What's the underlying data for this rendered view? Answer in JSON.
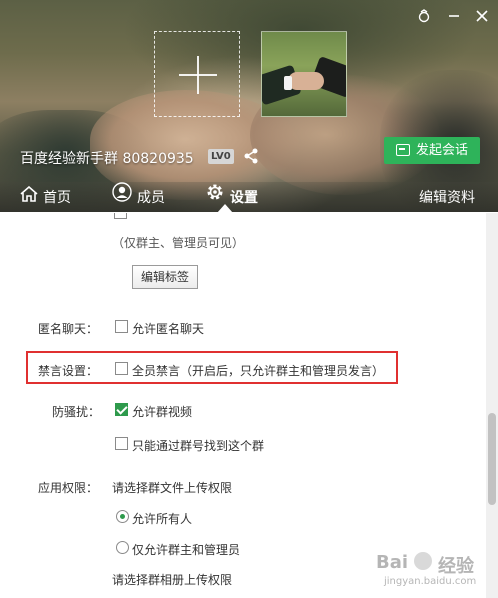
{
  "header": {
    "group_name": "百度经验新手群 80820935",
    "level": "LV0",
    "start_chat_label": "发起会话"
  },
  "nav": {
    "home": "首页",
    "members": "成员",
    "settings": "设置",
    "edit_profile": "编辑资料"
  },
  "content": {
    "visibility_note": "（仅群主、管理员可见）",
    "edit_tags_label": "编辑标签",
    "anonymous": {
      "label": "匿名聊天：",
      "option": "允许匿名聊天",
      "checked": false
    },
    "mute": {
      "label": "禁言设置：",
      "option": "全员禁言（开启后，只允许群主和管理员发言）",
      "checked": false
    },
    "anti_spam": {
      "label": "防骚扰：",
      "options": [
        {
          "text": "允许群视频",
          "checked": true
        },
        {
          "text": "只能通过群号找到这个群",
          "checked": false
        }
      ]
    },
    "permissions": {
      "label": "应用权限：",
      "file_upload_title": "请选择群文件上传权限",
      "file_upload_options": [
        {
          "text": "允许所有人",
          "selected": true
        },
        {
          "text": "仅允许群主和管理员",
          "selected": false
        }
      ],
      "album_upload_title": "请选择群相册上传权限"
    }
  },
  "watermark": {
    "brand_left": "Bai",
    "brand_right": "经验",
    "url": "jingyan.baidu.com"
  },
  "colors": {
    "accent_green": "#2eb35a",
    "highlight_red": "#e03030"
  }
}
